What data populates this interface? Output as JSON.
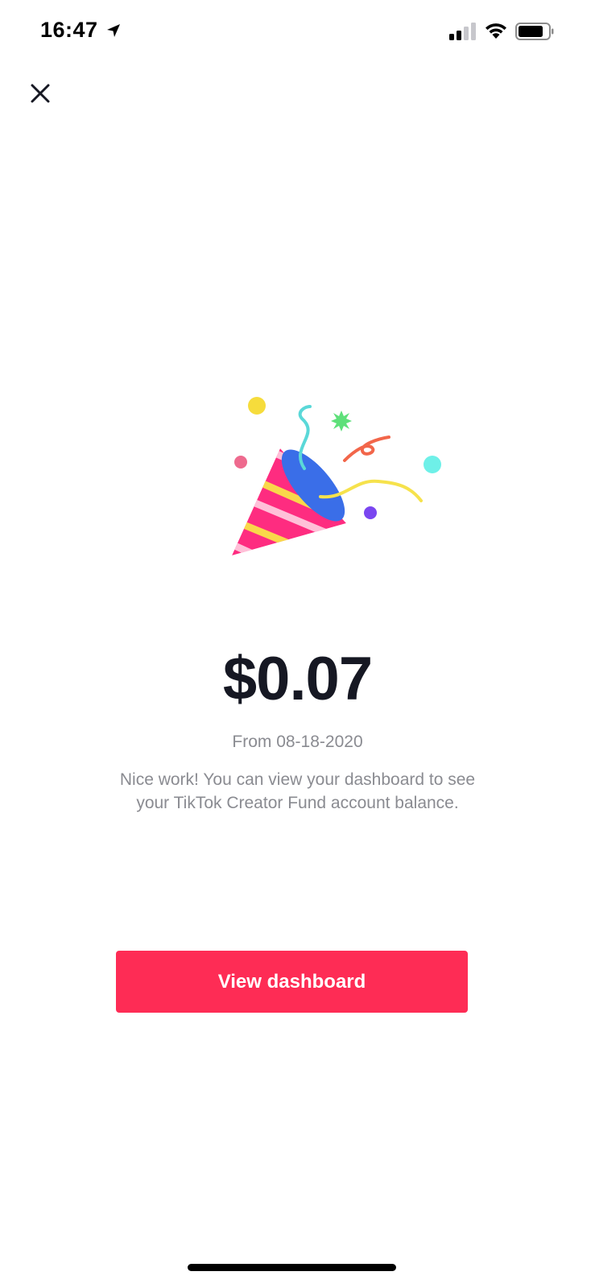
{
  "status_bar": {
    "time": "16:47",
    "location_icon": "location-arrow-icon",
    "signal_icon": "cellular-signal-icon",
    "wifi_icon": "wifi-icon",
    "battery_icon": "battery-icon",
    "signal_bars_active": 2,
    "signal_bars_total": 4,
    "battery_level": 0.75
  },
  "header": {
    "close_icon": "close-icon"
  },
  "illustration": {
    "icon": "party-popper-icon",
    "colors": {
      "cone_pink": "#fe2c80",
      "stripe_yellow": "#f9d84a",
      "stripe_light_pink": "#ffc0d8",
      "cone_opening_blue": "#3a6ee8",
      "streamer_cyan": "#5ad8d8",
      "streamer_red": "#f2664a",
      "streamer_yellow": "#f6e24c",
      "dot_yellow": "#f6dc3c",
      "dot_pink": "#ee6a8e",
      "dot_cyan": "#6ef0e8",
      "dot_purple": "#7a46f0",
      "star_green": "#5ee07a"
    }
  },
  "content": {
    "amount": "$0.07",
    "date_line": "From 08-18-2020",
    "message": "Nice work! You can view your dashboard to see your TikTok Creator Fund account balance."
  },
  "actions": {
    "view_dashboard_label": "View dashboard",
    "primary_color": "#fe2c55"
  }
}
